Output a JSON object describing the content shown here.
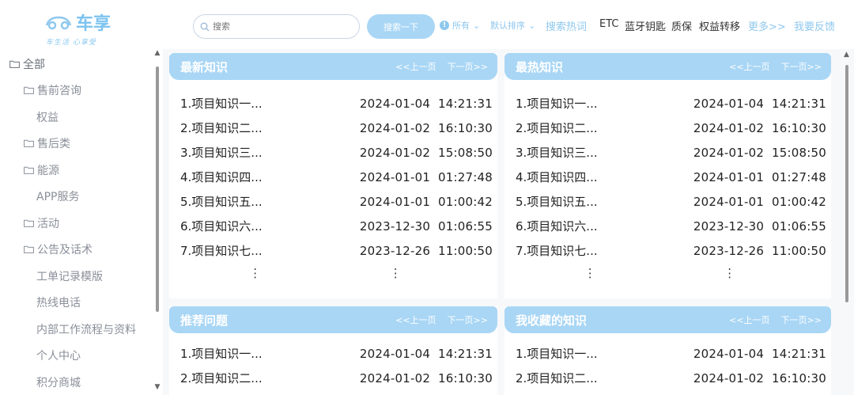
{
  "logo": {
    "name": "车享",
    "slogan": "车生活 心享受"
  },
  "sidebar": {
    "items": [
      {
        "label": "全部",
        "level": 0,
        "folder": true
      },
      {
        "label": "售前咨询",
        "level": 1,
        "folder": true
      },
      {
        "label": "权益",
        "level": 2,
        "folder": false
      },
      {
        "label": "售后类",
        "level": 1,
        "folder": true
      },
      {
        "label": "能源",
        "level": 1,
        "folder": true
      },
      {
        "label": "APP服务",
        "level": 2,
        "folder": false
      },
      {
        "label": "活动",
        "level": 1,
        "folder": true
      },
      {
        "label": "公告及话术",
        "level": 1,
        "folder": true
      },
      {
        "label": "工单记录模版",
        "level": 2,
        "folder": false
      },
      {
        "label": "热线电话",
        "level": 2,
        "folder": false
      },
      {
        "label": "内部工作流程与资料",
        "level": 2,
        "folder": false
      },
      {
        "label": "个人中心",
        "level": 2,
        "folder": false
      },
      {
        "label": "积分商城",
        "level": 2,
        "folder": false
      }
    ]
  },
  "search": {
    "placeholder": "搜索",
    "button": "搜索一下"
  },
  "filters": {
    "scope": "所有",
    "sort": "默认排序"
  },
  "hot": {
    "label": "搜索热词",
    "tags": [
      "ETC",
      "蓝牙钥匙",
      "质保",
      "权益转移"
    ],
    "more": "更多>>",
    "feedback": "我要反馈"
  },
  "nav": {
    "prev": "<<上一页",
    "next": "下一页>>"
  },
  "cards": [
    {
      "title": "最新知识",
      "rows": [
        {
          "name": "1.项目知识一...",
          "time": "2024-01-04  14:21:31"
        },
        {
          "name": "2.项目知识二...",
          "time": "2024-01-02  16:10:30"
        },
        {
          "name": "3.项目知识三...",
          "time": "2024-01-02  15:08:50"
        },
        {
          "name": "4.项目知识四...",
          "time": "2024-01-01  01:27:48"
        },
        {
          "name": "5.项目知识五...",
          "time": "2024-01-01  01:00:42"
        },
        {
          "name": "6.项目知识六...",
          "time": "2023-12-30  01:06:55"
        },
        {
          "name": "7.项目知识七...",
          "time": "2023-12-26  11:00:50"
        }
      ]
    },
    {
      "title": "最热知识",
      "rows": [
        {
          "name": "1.项目知识一...",
          "time": "2024-01-04  14:21:31"
        },
        {
          "name": "2.项目知识二...",
          "time": "2024-01-02  16:10:30"
        },
        {
          "name": "3.项目知识三...",
          "time": "2024-01-02  15:08:50"
        },
        {
          "name": "4.项目知识四...",
          "time": "2024-01-01  01:27:48"
        },
        {
          "name": "5.项目知识五...",
          "time": "2024-01-01  01:00:42"
        },
        {
          "name": "6.项目知识六...",
          "time": "2023-12-30  01:06:55"
        },
        {
          "name": "7.项目知识七...",
          "time": "2023-12-26  11:00:50"
        }
      ]
    },
    {
      "title": "推荐问题",
      "rows": [
        {
          "name": "1.项目知识一...",
          "time": "2024-01-04  14:21:31"
        },
        {
          "name": "2.项目知识二...",
          "time": "2024-01-02  16:10:30"
        }
      ]
    },
    {
      "title": "我收藏的知识",
      "rows": [
        {
          "name": "1.项目知识一...",
          "time": "2024-01-04  14:21:31"
        },
        {
          "name": "2.项目知识二...",
          "time": "2024-01-02  16:10:30"
        }
      ]
    }
  ],
  "colors": {
    "accent": "#a9d6f5",
    "accent_text": "#8fc8ee",
    "sidebar_text": "#8a8f99"
  }
}
